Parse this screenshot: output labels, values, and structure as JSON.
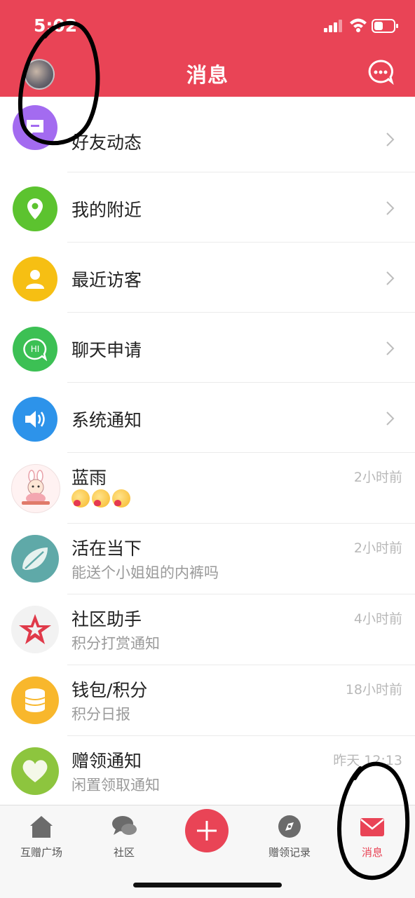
{
  "status_bar": {
    "time": "5:02"
  },
  "header": {
    "title": "消息",
    "avatar_icon": "user-avatar",
    "action_icon": "chat-bubble-icon"
  },
  "menu": [
    {
      "label": "好友动态",
      "icon": "chat-icon",
      "color": "#a36bf0"
    },
    {
      "label": "我的附近",
      "icon": "location-pin-icon",
      "color": "#5cc32f"
    },
    {
      "label": "最近访客",
      "icon": "person-icon",
      "color": "#f6bf13"
    },
    {
      "label": "聊天申请",
      "icon": "hi-bubble-icon",
      "color": "#3cc054"
    },
    {
      "label": "系统通知",
      "icon": "speaker-icon",
      "color": "#2d93ea"
    }
  ],
  "messages": [
    {
      "name": "蓝雨",
      "preview": "",
      "time": "2小时前",
      "avatar": "cartoon-girl-avatar"
    },
    {
      "name": "活在当下",
      "preview": "能送个小姐姐的内裤吗",
      "time": "2小时前",
      "avatar": "leaf-avatar"
    },
    {
      "name": "社区助手",
      "preview": "积分打赏通知",
      "time": "4小时前",
      "avatar": "star-logo-avatar"
    },
    {
      "name": "钱包/积分",
      "preview": "积分日报",
      "time": "18小时前",
      "avatar": "coins-avatar"
    },
    {
      "name": "赠领通知",
      "preview": "闲置领取通知",
      "time": "昨天 12:13",
      "avatar": "heart-avatar"
    }
  ],
  "tabs": [
    {
      "label": "互赠广场",
      "icon": "house-icon"
    },
    {
      "label": "社区",
      "icon": "speech-bubbles-icon"
    },
    {
      "label": "",
      "icon": "plus-icon"
    },
    {
      "label": "赠领记录",
      "icon": "compass-icon"
    },
    {
      "label": "消息",
      "icon": "envelope-icon"
    }
  ],
  "colors": {
    "brand": "#e94456",
    "active_tab": "#e94456",
    "inactive_tab": "#555555"
  }
}
